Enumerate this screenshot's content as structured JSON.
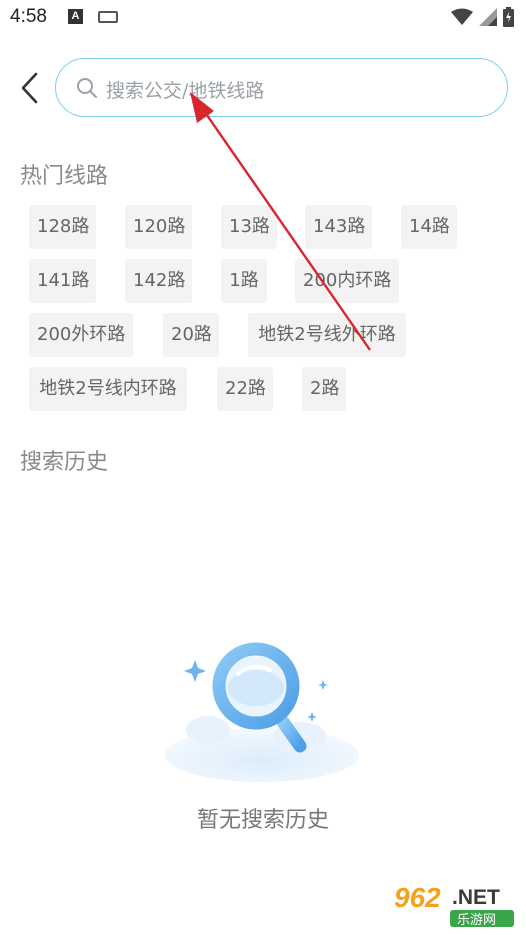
{
  "status_bar": {
    "time": "4:58",
    "notification_badge": "A"
  },
  "search": {
    "placeholder": "搜索公交/地铁线路"
  },
  "hot_lines": {
    "title": "热门线路",
    "items": [
      "128路",
      "120路",
      "13路",
      "143路",
      "14路",
      "141路",
      "142路",
      "1路",
      "200内环路",
      "200外环路",
      "20路",
      "地铁2号线外环路",
      "地铁2号线内环路",
      "22路",
      "2路"
    ]
  },
  "history": {
    "title": "搜索历史",
    "empty_text": "暂无搜索历史"
  },
  "watermark": {
    "brand": "962.NET",
    "subtitle": "乐游网"
  },
  "colors": {
    "search_border": "#7fd0ec",
    "tag_bg": "#f3f3f3",
    "annotation": "#d9262c",
    "accent_blue": "#5ab0ef"
  },
  "icons": [
    "back-arrow-icon",
    "search-icon",
    "wifi-icon",
    "signal-icon",
    "battery-icon",
    "keyboard-icon",
    "magnifier-illustration"
  ]
}
